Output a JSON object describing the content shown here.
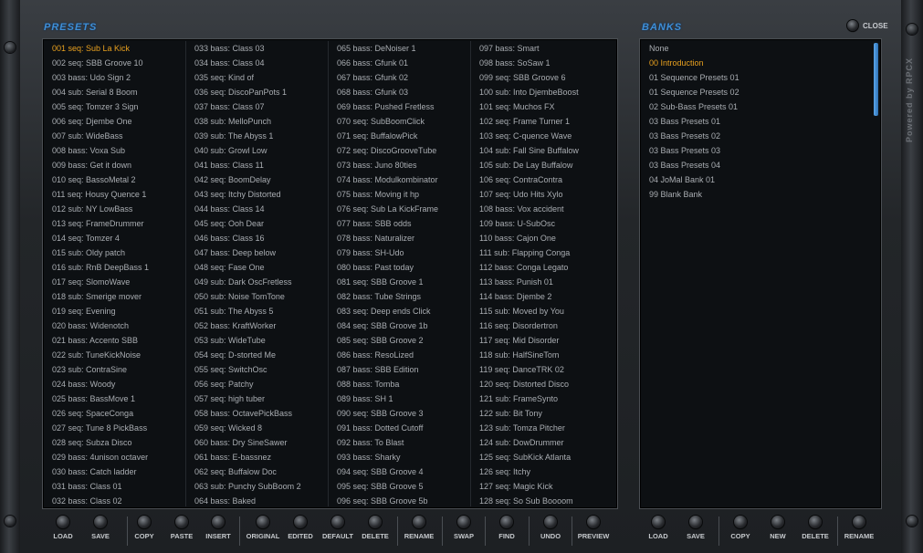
{
  "presets_title": "PRESETS",
  "banks_title": "BANKS",
  "close_label": "CLOSE",
  "powered_label": "Powered by RPCX",
  "preset_columns": [
    [
      "001 seq: Sub La Kick",
      "002 seq: SBB Groove 10",
      "003 bass: Udo Sign 2",
      "004 sub: Serial 8 Boom",
      "005 seq: Tomzer 3 Sign",
      "006 seq: Djembe One",
      "007 sub:  WideBass",
      "008 bass: Voxa Sub",
      "009 bass: Get it down",
      "010 seq: BassoMetal 2",
      "011 seq: Housy Quence 1",
      "012 sub: NY LowBass",
      "013 seq: FrameDrummer",
      "014 seq: Tomzer 4",
      "015 sub: Oldy patch",
      "016 sub: RnB DeepBass 1",
      "017 seq: SlomoWave",
      "018 sub: Smerige mover",
      "019 seq: Evening",
      "020 bass: Widenotch",
      "021 bass: Accento SBB",
      "022 sub: TuneKickNoise",
      "023 sub: ContraSine",
      "024 bass: Woody",
      "025 bass: BassMove 1",
      "026 seq: SpaceConga",
      "027 seq: Tune 8 PickBass",
      "028 seq: Subza Disco",
      "029 bass: 4unison octaver",
      "030 bass: Catch ladder",
      "031 bass: Class 01",
      "032 bass: Class 02"
    ],
    [
      "033 bass: Class 03",
      "034 bass: Class 04",
      "035 seq: Kind of",
      "036 seq: DiscoPanPots 1",
      "037 bass: Class 07",
      "038 sub: MelloPunch",
      "039 sub: The Abyss 1",
      "040 sub: Growl Low",
      "041 bass: Class 11",
      "042 seq: BoomDelay",
      "043 seq: Itchy Distorted",
      "044 bass: Class 14",
      "045 seq: Ooh Dear",
      "046 bass: Class 16",
      "047 bass: Deep below",
      "048 seq: Fase One",
      "049 sub: Dark  OscFretless",
      "050 sub: Noise TomTone",
      "051 sub: The Abyss 5",
      "052 bass: KraftWorker",
      "053 sub: WideTube",
      "054 seq: D-storted Me",
      "055 seq: SwitchOsc",
      "056 seq: Patchy",
      "057 seq: high tuber",
      "058 bass: OctavePickBass",
      "059 seq: Wicked 8",
      "060 bass: Dry SineSawer",
      "061 bass: E-bassnez",
      "062 seq: Buffalow Doc",
      "063 sub: Punchy SubBoom 2",
      "064 bass: Baked"
    ],
    [
      "065 bass: DeNoiser 1",
      "066 bass: Gfunk 01",
      "067 bass: Gfunk 02",
      "068 bass: Gfunk 03",
      "069 bass: Pushed Fretless",
      "070 seq: SubBoomClick",
      "071 seq: BuffalowPick",
      "072 seq: DiscoGrooveTube",
      "073 bass: Juno 80ties",
      "074 bass: Modulkombinator",
      "075 bass: Moving it hp",
      "076 seq: Sub La KickFrame",
      "077 bass: SBB odds",
      "078 bass: Naturalizer",
      "079 bass: SH-Udo",
      "080 bass: Past today",
      "081 seq: SBB Groove 1",
      "082 bass: Tube Strings",
      "083 seq: Deep ends Click",
      "084 seq: SBB Groove 1b",
      "085 seq: SBB Groove 2",
      "086 bass: ResoLized",
      "087 bass: SBB Edition",
      "088 bass: Tomba",
      "089 bass: SH 1",
      "090 seq: SBB Groove 3",
      "091 bass: Dotted Cutoff",
      "092 bass: To Blast",
      "093 bass: Sharky",
      "094 seq: SBB Groove 4",
      "095 seq: SBB Groove 5",
      "096 seq: SBB Groove 5b"
    ],
    [
      "097 bass: Smart",
      "098 bass: SoSaw 1",
      "099 seq: SBB Groove 6",
      "100 sub: Into DjembeBoost",
      "101 seq: Muchos FX",
      "102 seq: Frame Turner 1",
      "103 seq: C-quence Wave",
      "104 sub: Fall Sine Buffalow",
      "105 sub: De Lay Buffalow",
      "106 seq: ContraContra",
      "107 seq: Udo Hits Xylo",
      "108 bass: Vox accident",
      "109 bass: U-SubOsc",
      "110 bass: Cajon One",
      "111 sub: Flapping Conga",
      "112 bass: Conga Legato",
      "113 bass: Punish 01",
      "114 bass: Djembe 2",
      "115 sub: Moved by You",
      "116 seq: Disordertron",
      "117 seq: Mid Disorder",
      "118 sub: HalfSineTom",
      "119 seq: DanceTRK 02",
      "120 seq: Distorted Disco",
      "121 sub: FrameSynto",
      "122 sub: Bit Tony",
      "123 sub: Tomza Pitcher",
      "124 sub: DowDrummer",
      "125 seq: SubKick Atlanta",
      "126 seq: Itchy",
      "127 seq: Magic Kick",
      "128 seq: So Sub Boooom"
    ]
  ],
  "banks": [
    "None",
    "00 Introduction",
    "01 Sequence Presets 01",
    "01 Sequence Presets 02",
    "02 Sub-Bass Presets 01",
    "03 Bass Presets 01",
    "03 Bass Presets 02",
    "03 Bass Presets 03",
    "03 Bass Presets 04",
    "04 JoMal Bank 01",
    "99 Blank Bank"
  ],
  "toolbar": {
    "load": "LOAD",
    "save": "SAVE",
    "copy": "COPY",
    "paste": "PASTE",
    "insert": "INSERT",
    "original": "ORIGINAL",
    "edited": "EDITED",
    "default": "DEFAULT",
    "delete": "DELETE",
    "rename": "RENAME",
    "swap": "SWAP",
    "find": "FIND",
    "undo": "UNDO",
    "preview": "PREVIEW",
    "bank_load": "LOAD",
    "bank_save": "SAVE",
    "bank_copy": "COPY",
    "bank_new": "NEW",
    "bank_delete": "DELETE",
    "bank_rename": "RENAME"
  },
  "colors": {
    "accent": "#3f8fd6",
    "selected": "#e9a11f",
    "text": "#a9adb2"
  }
}
